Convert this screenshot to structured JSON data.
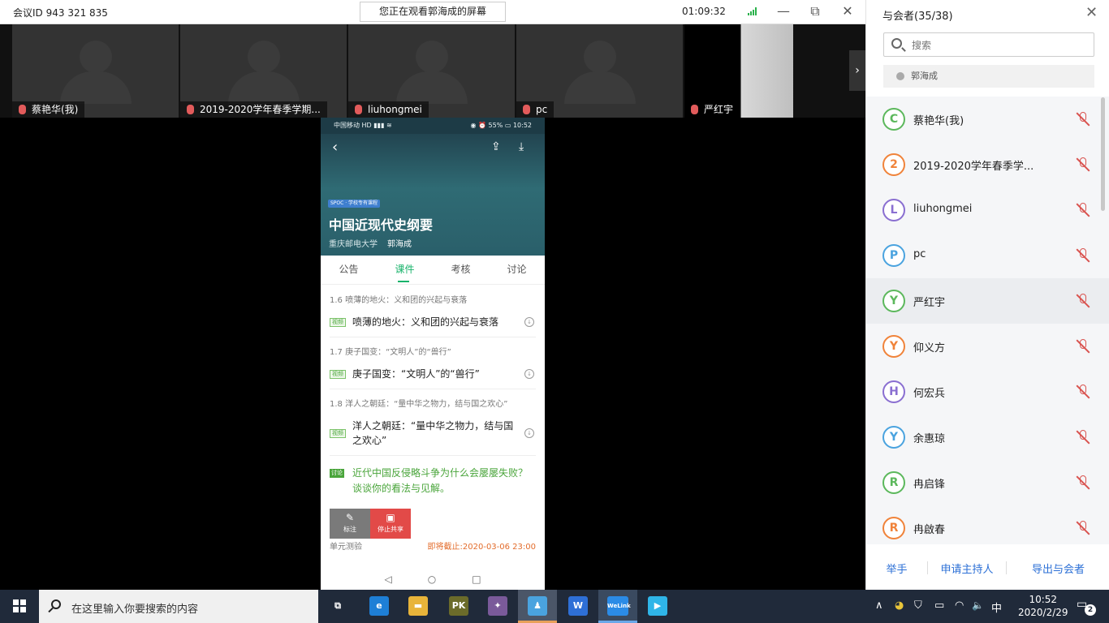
{
  "topbar": {
    "meeting_id": "会议ID 943 321 835",
    "sharing_notice": "您正在观看郭海成的屏幕",
    "timer": "01:09:32",
    "minimize": "—",
    "restore": "⧉",
    "close": "✕"
  },
  "video_strip": {
    "tiles": [
      {
        "name": "蔡艳华(我)"
      },
      {
        "name": "2019-2020学年春季学期..."
      },
      {
        "name": "liuhongmei"
      },
      {
        "name": "pc"
      },
      {
        "name": "严红宇"
      }
    ],
    "next_icon": "chevron-right-icon",
    "next_glyph": "›"
  },
  "phone": {
    "status_left": "中国移动 HD ▮▮▮ ≋",
    "status_right": "◉ ⏰ 55% ▭ 10:52",
    "back_glyph": "‹",
    "share_glyph": "⇪",
    "download_glyph": "⤓",
    "course_tag": "SPOC · 学校专有课程",
    "course_title": "中国近现代史纲要",
    "school": "重庆邮电大学",
    "teacher": "郭海成",
    "tabs": [
      "公告",
      "课件",
      "考核",
      "讨论"
    ],
    "active_tab": "课件",
    "sections": [
      {
        "header": "1.6 喷薄的地火：义和团的兴起与衰落",
        "tag": "视频",
        "title": "喷薄的地火：义和团的兴起与衰落"
      },
      {
        "header": "1.7 庚子国变：“文明人”的“兽行”",
        "tag": "视频",
        "title": "庚子国变：“文明人”的“兽行”"
      },
      {
        "header": "1.8 洋人之朝廷：“量中华之物力，结与国之欢心”",
        "tag": "视频",
        "title": "洋人之朝廷：“量中华之物力，结与国之欢心”"
      }
    ],
    "download_item_glyph": "↓",
    "discussion": {
      "tag": "讨论",
      "text": "近代中国反侵略斗争为什么会屡屡失败？谈谈你的看法与见解。"
    },
    "overlay_buttons": [
      {
        "label": "标注",
        "icon": "pen-icon",
        "glyph": "✎",
        "color": "#7a7a7a"
      },
      {
        "label": "停止共享",
        "icon": "stop-share-icon",
        "glyph": "▣",
        "color": "#e24a48"
      }
    ],
    "unit_test": "单元测验",
    "deadline": "即将截止:2020-03-06 23:00",
    "nav": [
      "◁",
      "○",
      "□"
    ]
  },
  "panel": {
    "title": "与会者(35/38)",
    "close": "✕",
    "search_placeholder": "搜索",
    "host": "郭海成",
    "participants": [
      {
        "name": "蔡艳华(我)",
        "initial": "C",
        "color": "#5cb85c",
        "highlight": false
      },
      {
        "name": "2019-2020学年春季学...",
        "initial": "2",
        "color": "#f0833a",
        "highlight": false
      },
      {
        "name": "liuhongmei",
        "initial": "L",
        "color": "#8a6fd1",
        "highlight": false
      },
      {
        "name": "pc",
        "initial": "P",
        "color": "#4aa3df",
        "highlight": false
      },
      {
        "name": "严红宇",
        "initial": "Y",
        "color": "#5cb85c",
        "highlight": true
      },
      {
        "name": "仰义方",
        "initial": "Y",
        "color": "#f0833a",
        "highlight": false
      },
      {
        "name": "何宏兵",
        "initial": "H",
        "color": "#8a6fd1",
        "highlight": false
      },
      {
        "name": "余惠琼",
        "initial": "Y",
        "color": "#4aa3df",
        "highlight": false
      },
      {
        "name": "冉启锋",
        "initial": "R",
        "color": "#5cb85c",
        "highlight": false
      },
      {
        "name": "冉啟春",
        "initial": "R",
        "color": "#f0833a",
        "highlight": false
      }
    ],
    "actions": [
      "举手",
      "申请主持人",
      "导出与会者"
    ]
  },
  "taskbar": {
    "search_placeholder": "在这里输入你要搜索的内容",
    "apps": [
      {
        "icon": "task-view-icon",
        "glyph": "⧉",
        "color": "#202a3a"
      },
      {
        "icon": "edge-icon",
        "glyph": "e",
        "color": "#1e7fd6"
      },
      {
        "icon": "file-explorer-icon",
        "glyph": "▬",
        "color": "#e8b43a"
      },
      {
        "icon": "game-app-icon",
        "glyph": "PK",
        "color": "#6b6b2a"
      },
      {
        "icon": "game-app-2-icon",
        "glyph": "✦",
        "color": "#7a5a9a"
      },
      {
        "icon": "contacts-app-icon",
        "glyph": "♟",
        "color": "#4aa3df"
      },
      {
        "icon": "wps-icon",
        "glyph": "W",
        "color": "#2e6fd6"
      },
      {
        "icon": "welink-icon",
        "glyph": "WeLink",
        "color": "#2b8be6"
      },
      {
        "icon": "video-app-icon",
        "glyph": "▶",
        "color": "#2fb5e8"
      }
    ],
    "tray": [
      {
        "icon": "tray-up-arrow-icon",
        "glyph": "∧"
      },
      {
        "icon": "tray-mascot-icon",
        "glyph": "◕"
      },
      {
        "icon": "defender-icon",
        "glyph": "⛉"
      },
      {
        "icon": "battery-icon",
        "glyph": "▭"
      },
      {
        "icon": "wifi-icon",
        "glyph": "◠"
      },
      {
        "icon": "volume-icon",
        "glyph": "🔈"
      },
      {
        "icon": "ime-icon",
        "glyph": "中"
      }
    ],
    "time": "10:52",
    "date": "2020/2/29",
    "notifications": "2"
  }
}
